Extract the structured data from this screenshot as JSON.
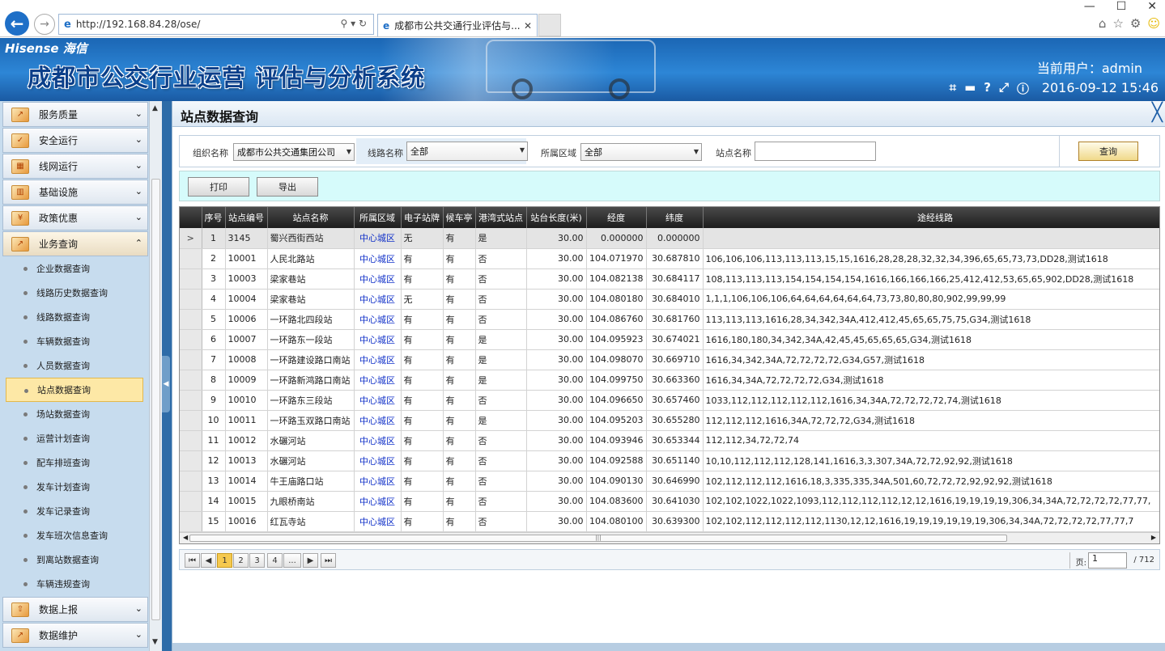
{
  "browser": {
    "url": "http://192.168.84.28/ose/",
    "tab_title": "成都市公共交通行业评估与...",
    "addr_tools": "⚲ ▾ ↻",
    "tab_close": "✕",
    "window_controls": [
      "—",
      "☐",
      "✕"
    ],
    "icons": [
      "home-icon",
      "star-icon",
      "gear-icon",
      "smiley-icon"
    ]
  },
  "header": {
    "logo": "Hisense 海信",
    "system_title": "成都市公交行业运营 评估与分析系统",
    "user_label": "当前用户：admin",
    "datetime": "2016-09-12 15:46",
    "tools": [
      "crop-icon",
      "keyboard-icon",
      "help-icon",
      "expand-icon",
      "info-icon"
    ]
  },
  "sidebar": {
    "groups_before": [
      {
        "label": "服务质量",
        "icon": "chart-icon"
      },
      {
        "label": "安全运行",
        "icon": "check-icon"
      },
      {
        "label": "线网运行",
        "icon": "grid-icon"
      },
      {
        "label": "基础设施",
        "icon": "building-icon"
      },
      {
        "label": "政策优惠",
        "icon": "coin-icon"
      }
    ],
    "open_group": {
      "label": "业务查询",
      "icon": "chart-icon"
    },
    "items": [
      "企业数据查询",
      "线路历史数据查询",
      "线路数据查询",
      "车辆数据查询",
      "人员数据查询",
      "站点数据查询",
      "场站数据查询",
      "运营计划查询",
      "配车排班查询",
      "发车计划查询",
      "发车记录查询",
      "发车班次信息查询",
      "到离站数据查询",
      "车辆违规查询"
    ],
    "active_item": "站点数据查询",
    "groups_after": [
      {
        "label": "数据上报",
        "icon": "upload-icon"
      },
      {
        "label": "数据维护",
        "icon": "chart-icon"
      }
    ]
  },
  "panel": {
    "title": "站点数据查询",
    "close": "╳"
  },
  "filters": {
    "org_label": "组织名称",
    "org_value": "成都市公共交通集团公司",
    "line_label": "线路名称",
    "line_value": "全部",
    "area_label": "所属区域",
    "area_value": "全部",
    "site_label": "站点名称",
    "site_value": "",
    "query_label": "查询"
  },
  "actions": {
    "print": "打印",
    "export": "导出"
  },
  "grid": {
    "columns": [
      "序号",
      "站点编号",
      "站点名称",
      "所属区域",
      "电子站牌",
      "候车亭",
      "港湾式站点",
      "站台长度(米)",
      "经度",
      "纬度",
      "途经线路"
    ],
    "rows": [
      [
        "1",
        "3145",
        "蜀兴西街西站",
        "中心城区",
        "无",
        "有",
        "是",
        "30.00",
        "0.000000",
        "0.000000",
        ""
      ],
      [
        "2",
        "10001",
        "人民北路站",
        "中心城区",
        "有",
        "有",
        "否",
        "30.00",
        "104.071970",
        "30.687810",
        "106,106,106,113,113,113,15,15,1616,28,28,28,32,32,34,396,65,65,73,73,DD28,测试1618"
      ],
      [
        "3",
        "10003",
        "梁家巷站",
        "中心城区",
        "有",
        "有",
        "否",
        "30.00",
        "104.082138",
        "30.684117",
        "108,113,113,113,154,154,154,154,1616,166,166,166,25,412,412,53,65,65,902,DD28,测试1618"
      ],
      [
        "4",
        "10004",
        "梁家巷站",
        "中心城区",
        "无",
        "有",
        "否",
        "30.00",
        "104.080180",
        "30.684010",
        "1,1,1,106,106,106,64,64,64,64,64,64,73,73,80,80,80,902,99,99,99"
      ],
      [
        "5",
        "10006",
        "一环路北四段站",
        "中心城区",
        "有",
        "有",
        "否",
        "30.00",
        "104.086760",
        "30.681760",
        "113,113,113,1616,28,34,342,34A,412,412,45,65,65,75,75,G34,测试1618"
      ],
      [
        "6",
        "10007",
        "一环路东一段站",
        "中心城区",
        "有",
        "有",
        "是",
        "30.00",
        "104.095923",
        "30.674021",
        "1616,180,180,34,342,34A,42,45,45,65,65,65,G34,测试1618"
      ],
      [
        "7",
        "10008",
        "一环路建设路口南站",
        "中心城区",
        "有",
        "有",
        "是",
        "30.00",
        "104.098070",
        "30.669710",
        "1616,34,342,34A,72,72,72,72,G34,G57,测试1618"
      ],
      [
        "8",
        "10009",
        "一环路新鸿路口南站",
        "中心城区",
        "有",
        "有",
        "是",
        "30.00",
        "104.099750",
        "30.663360",
        "1616,34,34A,72,72,72,72,G34,测试1618"
      ],
      [
        "9",
        "10010",
        "一环路东三段站",
        "中心城区",
        "有",
        "有",
        "否",
        "30.00",
        "104.096650",
        "30.657460",
        "1033,112,112,112,112,112,1616,34,34A,72,72,72,72,74,测试1618"
      ],
      [
        "10",
        "10011",
        "一环路玉双路口南站",
        "中心城区",
        "有",
        "有",
        "是",
        "30.00",
        "104.095203",
        "30.655280",
        "112,112,112,1616,34A,72,72,72,G34,测试1618"
      ],
      [
        "11",
        "10012",
        "水碾河站",
        "中心城区",
        "有",
        "有",
        "否",
        "30.00",
        "104.093946",
        "30.653344",
        "112,112,34,72,72,74"
      ],
      [
        "12",
        "10013",
        "水碾河站",
        "中心城区",
        "有",
        "有",
        "否",
        "30.00",
        "104.092588",
        "30.651140",
        "10,10,112,112,112,128,141,1616,3,3,307,34A,72,72,92,92,测试1618"
      ],
      [
        "13",
        "10014",
        "牛王庙路口站",
        "中心城区",
        "有",
        "有",
        "否",
        "30.00",
        "104.090130",
        "30.646990",
        "102,112,112,112,1616,18,3,335,335,34A,501,60,72,72,72,92,92,92,测试1618"
      ],
      [
        "14",
        "10015",
        "九眼桥南站",
        "中心城区",
        "有",
        "有",
        "否",
        "30.00",
        "104.083600",
        "30.641030",
        "102,102,1022,1022,1093,112,112,112,112,12,12,1616,19,19,19,19,306,34,34A,72,72,72,72,77,77,"
      ],
      [
        "15",
        "10016",
        "红瓦寺站",
        "中心城区",
        "有",
        "有",
        "否",
        "30.00",
        "104.080100",
        "30.639300",
        "102,102,112,112,112,112,1130,12,12,1616,19,19,19,19,19,19,306,34,34A,72,72,72,72,77,77,7"
      ]
    ],
    "selected_row_marker": ">"
  },
  "pager": {
    "pages": [
      "1",
      "2",
      "3",
      "4",
      "..."
    ],
    "current_page": "1",
    "page_label": "页:",
    "page_input": "1",
    "total": "/ 712"
  }
}
